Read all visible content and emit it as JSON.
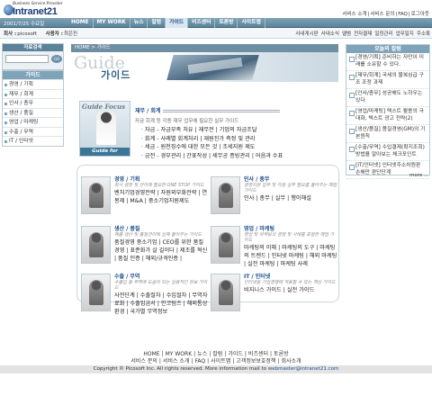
{
  "header": {
    "logo_sub": "Business Service Provider",
    "logo_word": "Intranet21",
    "top_links": [
      "서비스 소개",
      "서비스 문의",
      "FAQ",
      "로그아웃"
    ],
    "date": "2001/7/25 수요일",
    "gnb": [
      "HOME",
      "MY WORK",
      "뉴스",
      "칼럼",
      "가이드",
      "비즈센터",
      "토론방",
      "사이트맵"
    ],
    "gnb_active": "가이드"
  },
  "userbar": {
    "company_label": "회사 :",
    "company_value": "picosoft",
    "user_label": "사용자 :",
    "user_value": "최은진",
    "submenu": [
      "사내게시판",
      "사내소식",
      "앨범",
      "전자결재",
      "일정관리",
      "업무일지",
      "주소록"
    ]
  },
  "login": {
    "title": "자료검색",
    "button": "GO"
  },
  "lnb": {
    "title": "가이드",
    "items": [
      "경영 / 기획",
      "재무 / 회계",
      "인사 / 총무",
      "생산 / 품질",
      "영업 / 마케팅",
      "수출 / 무역",
      "IT / 인터넷"
    ]
  },
  "breadcrumb": "HOME > 가이드",
  "banner": {
    "title_en": "Guide",
    "title_ko": "가이드"
  },
  "focus": {
    "label": "Guide Focus",
    "caption": "Guide for Bissness",
    "title": "재무 / 회계",
    "desc": "자금 회계 등 각종 재무 업무에 필요한 실무 가이드",
    "items": [
      "· 자금 - 자금부족 처유 | 재무전 | 기업의 자금조달",
      "· 회계 - 사례별 회계처리 | 재원진가 측정 및 관리",
      "· 세금 - 원천징수에 대한 모든 것 | 조세지원 제도",
      "· 금전 - 경부관리 | 간표작성 | 세무공 증빙관리 | 어음과 수표"
    ]
  },
  "categories": [
    {
      "title": "경영 / 기획",
      "sub": "회사 경영 및 관리에 필요한 ONE STOP 가이드",
      "links": "벤처기업경영전략 | 자원외부화전략 | 연봉제 | M&A | 중소기업지원제도"
    },
    {
      "title": "인사 / 총무",
      "sub": "경영지원 업무 및 각종 실무 필요를 풀어주는 해법 가이드",
      "links": "인사 | 총무 | 실무 | 행이해설"
    },
    {
      "title": "생산 / 품질",
      "sub": "제품 생산 및 품질관리에 실제 풀어주는 가이드",
      "links": "품질경영 중소기업 | CEO를 위한 품질경영 | 표준화가 살 길이다 | 제조를 혁신 | 품질 인증 | 해외/규격인증 |"
    },
    {
      "title": "영업 / 마케팅",
      "sub": "영업 및 마케팅의 경쟁 및 사례를 포함한 해법 가이드",
      "links": "마케팅의 이해 | 마케팅의 도구 | 마케팅의 트렌드 | 인터넷 마케팅 | 해외 마케팅 | 실전 마케팅 | 마케팅 사례"
    },
    {
      "title": "수출 / 무역",
      "sub": "수출입 등 무역에 도움이 되는 실용적인 정보 가이드",
      "links": "사전단계 | 수출절차 | 수입절차 | 무역자료화 | 수출입금서 | 인코텀즈 | 해외통상환경 | 국가별 무역정보"
    },
    {
      "title": "IT / 인터넷",
      "sub": "인터넷을 기업경쟁에 적용할 수 있는 핵심 가이드",
      "links": "비지니스 가이드 | 실전 가이드"
    }
  ],
  "hot": {
    "title": "오늘의 칼럼",
    "items": [
      "[경영/기획] 준비하는 자만이 미래를 소유할 수 있다.",
      "[재무/회계] 국세의 불복심급 구조 조정 과제",
      "[인사/총무] 성공해도 노하우는 있다",
      "[영업/마케팅] 텍스트 활용의 극대화, 텍스트 광고 전략(2)",
      "[생산/품질] 품질경영(GM)의 기본원칙",
      "[수출/무역] 수입결제(확지조회) 방법을 알아보는 체크포인트",
      "[IT/인터넷] 인터넷주소차원판 손해만 판단단계"
    ],
    "more": "more ..."
  },
  "footer": {
    "nav1": [
      "HOME",
      "MY WORK",
      "뉴스",
      "칼럼",
      "가이드",
      "비즈센터",
      "토론방"
    ],
    "nav2": [
      "서비스 문의",
      "서비스 소개",
      "FAQ",
      "사이트맵",
      "고객정보보호정책",
      "회사소개"
    ],
    "copyright": "Copyright © Picosoft Inc. All rights reserved. More information mail to",
    "email": "webmaster@intranet21.com"
  }
}
